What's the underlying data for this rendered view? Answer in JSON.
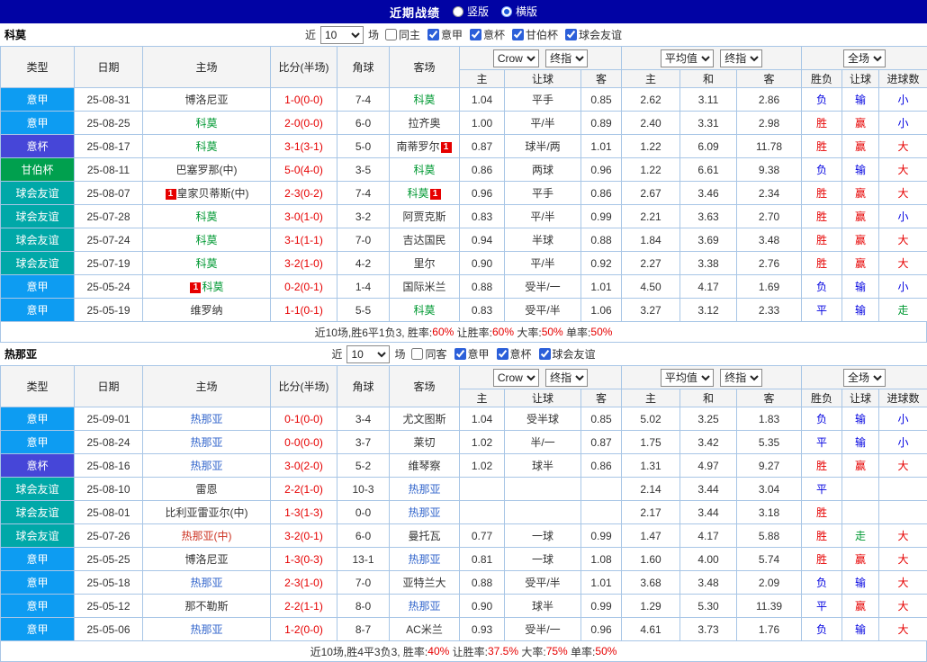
{
  "topbar": {
    "title": "近期战绩",
    "radios": [
      {
        "label": "竖版",
        "selected": false
      },
      {
        "label": "横版",
        "selected": true
      }
    ]
  },
  "colors": {
    "league": {
      "意甲": "#0d9cf2",
      "意杯": "#4646d8",
      "甘伯杯": "#00a04e",
      "球会友谊": "#00a8a8"
    },
    "result": {
      "red": "#e60000",
      "blue": "#0000e0",
      "green": "#009933"
    },
    "text_dark": "#333333",
    "score": "#e60000",
    "badge": "#e60000"
  },
  "head": {
    "type": "类型",
    "date": "日期",
    "home": "主场",
    "score": "比分(半场)",
    "corner": "角球",
    "away": "客场",
    "odds_selects": [
      "Crow",
      "终指"
    ],
    "avg_selects": [
      "平均值",
      "终指"
    ],
    "scope_selects": [
      "全场"
    ],
    "sub": [
      "主",
      "让球",
      "客",
      "主",
      "和",
      "客",
      "胜负",
      "让球",
      "进球数"
    ]
  },
  "tables": [
    {
      "team": "科莫",
      "focal_color": "#009933",
      "filter": {
        "near": "近",
        "count": "10",
        "games": "场",
        "checks": [
          {
            "label": "同主",
            "checked": false
          },
          {
            "label": "意甲",
            "checked": true
          },
          {
            "label": "意杯",
            "checked": true
          },
          {
            "label": "甘伯杯",
            "checked": true
          },
          {
            "label": "球会友谊",
            "checked": true
          }
        ]
      },
      "rows": [
        {
          "league": "意甲",
          "date": "25-08-31",
          "home": {
            "text": "博洛尼亚"
          },
          "score": "1-0(0-0)",
          "corner": "7-4",
          "away": {
            "text": "科莫",
            "focal": true
          },
          "odds": [
            "1.04",
            "平手",
            "0.85"
          ],
          "avg": [
            "2.62",
            "3.11",
            "2.86"
          ],
          "res": [
            {
              "t": "负",
              "c": "blue"
            },
            {
              "t": "输",
              "c": "blue"
            },
            {
              "t": "小",
              "c": "blue"
            }
          ]
        },
        {
          "league": "意甲",
          "date": "25-08-25",
          "home": {
            "text": "科莫",
            "focal": true
          },
          "score": "2-0(0-0)",
          "corner": "6-0",
          "away": {
            "text": "拉齐奥"
          },
          "odds": [
            "1.00",
            "平/半",
            "0.89"
          ],
          "avg": [
            "2.40",
            "3.31",
            "2.98"
          ],
          "res": [
            {
              "t": "胜",
              "c": "red"
            },
            {
              "t": "赢",
              "c": "red"
            },
            {
              "t": "小",
              "c": "blue"
            }
          ]
        },
        {
          "league": "意杯",
          "date": "25-08-17",
          "home": {
            "text": "科莫",
            "focal": true
          },
          "score": "3-1(3-1)",
          "corner": "5-0",
          "away": {
            "text": "南蒂罗尔",
            "post": "1"
          },
          "odds": [
            "0.87",
            "球半/两",
            "1.01"
          ],
          "avg": [
            "1.22",
            "6.09",
            "11.78"
          ],
          "res": [
            {
              "t": "胜",
              "c": "red"
            },
            {
              "t": "赢",
              "c": "red"
            },
            {
              "t": "大",
              "c": "red"
            }
          ]
        },
        {
          "league": "甘伯杯",
          "date": "25-08-11",
          "home": {
            "text": "巴塞罗那(中)"
          },
          "score": "5-0(4-0)",
          "corner": "3-5",
          "away": {
            "text": "科莫",
            "focal": true
          },
          "odds": [
            "0.86",
            "两球",
            "0.96"
          ],
          "avg": [
            "1.22",
            "6.61",
            "9.38"
          ],
          "res": [
            {
              "t": "负",
              "c": "blue"
            },
            {
              "t": "输",
              "c": "blue"
            },
            {
              "t": "大",
              "c": "red"
            }
          ]
        },
        {
          "league": "球会友谊",
          "date": "25-08-07",
          "home": {
            "pre": "1",
            "text": "皇家贝蒂斯(中)"
          },
          "score": "2-3(0-2)",
          "corner": "7-4",
          "away": {
            "text": "科莫",
            "focal": true,
            "post": "1"
          },
          "odds": [
            "0.96",
            "平手",
            "0.86"
          ],
          "avg": [
            "2.67",
            "3.46",
            "2.34"
          ],
          "res": [
            {
              "t": "胜",
              "c": "red"
            },
            {
              "t": "赢",
              "c": "red"
            },
            {
              "t": "大",
              "c": "red"
            }
          ]
        },
        {
          "league": "球会友谊",
          "date": "25-07-28",
          "home": {
            "text": "科莫",
            "focal": true
          },
          "score": "3-0(1-0)",
          "corner": "3-2",
          "away": {
            "text": "阿贾克斯"
          },
          "odds": [
            "0.83",
            "平/半",
            "0.99"
          ],
          "avg": [
            "2.21",
            "3.63",
            "2.70"
          ],
          "res": [
            {
              "t": "胜",
              "c": "red"
            },
            {
              "t": "赢",
              "c": "red"
            },
            {
              "t": "小",
              "c": "blue"
            }
          ]
        },
        {
          "league": "球会友谊",
          "date": "25-07-24",
          "home": {
            "text": "科莫",
            "focal": true
          },
          "score": "3-1(1-1)",
          "corner": "7-0",
          "away": {
            "text": "吉达国民"
          },
          "odds": [
            "0.94",
            "半球",
            "0.88"
          ],
          "avg": [
            "1.84",
            "3.69",
            "3.48"
          ],
          "res": [
            {
              "t": "胜",
              "c": "red"
            },
            {
              "t": "赢",
              "c": "red"
            },
            {
              "t": "大",
              "c": "red"
            }
          ]
        },
        {
          "league": "球会友谊",
          "date": "25-07-19",
          "home": {
            "text": "科莫",
            "focal": true
          },
          "score": "3-2(1-0)",
          "corner": "4-2",
          "away": {
            "text": "里尔"
          },
          "odds": [
            "0.90",
            "平/半",
            "0.92"
          ],
          "avg": [
            "2.27",
            "3.38",
            "2.76"
          ],
          "res": [
            {
              "t": "胜",
              "c": "red"
            },
            {
              "t": "赢",
              "c": "red"
            },
            {
              "t": "大",
              "c": "red"
            }
          ]
        },
        {
          "league": "意甲",
          "date": "25-05-24",
          "home": {
            "pre": "1",
            "text": "科莫",
            "focal": true
          },
          "score": "0-2(0-1)",
          "corner": "1-4",
          "away": {
            "text": "国际米兰"
          },
          "odds": [
            "0.88",
            "受半/一",
            "1.01"
          ],
          "avg": [
            "4.50",
            "4.17",
            "1.69"
          ],
          "res": [
            {
              "t": "负",
              "c": "blue"
            },
            {
              "t": "输",
              "c": "blue"
            },
            {
              "t": "小",
              "c": "blue"
            }
          ]
        },
        {
          "league": "意甲",
          "date": "25-05-19",
          "home": {
            "text": "维罗纳"
          },
          "score": "1-1(0-1)",
          "corner": "5-5",
          "away": {
            "text": "科莫",
            "focal": true
          },
          "odds": [
            "0.83",
            "受平/半",
            "1.06"
          ],
          "avg": [
            "3.27",
            "3.12",
            "2.33"
          ],
          "res": [
            {
              "t": "平",
              "c": "blue"
            },
            {
              "t": "输",
              "c": "blue"
            },
            {
              "t": "走",
              "c": "green"
            }
          ]
        }
      ],
      "summary": [
        {
          "t": "近10场,胜6平1负3, 胜率:",
          "c": "dark"
        },
        {
          "t": "60%",
          "c": "red"
        },
        {
          "t": " 让胜率:",
          "c": "dark"
        },
        {
          "t": "60%",
          "c": "red"
        },
        {
          "t": " 大率:",
          "c": "dark"
        },
        {
          "t": "50%",
          "c": "red"
        },
        {
          "t": " 单率:",
          "c": "dark"
        },
        {
          "t": "50%",
          "c": "red"
        }
      ]
    },
    {
      "team": "热那亚",
      "focal_color": "#3366cc",
      "filter": {
        "near": "近",
        "count": "10",
        "games": "场",
        "checks": [
          {
            "label": "同客",
            "checked": false
          },
          {
            "label": "意甲",
            "checked": true
          },
          {
            "label": "意杯",
            "checked": true
          },
          {
            "label": "球会友谊",
            "checked": true
          }
        ]
      },
      "rows": [
        {
          "league": "意甲",
          "date": "25-09-01",
          "home": {
            "text": "热那亚",
            "focal": true
          },
          "score": "0-1(0-0)",
          "corner": "3-4",
          "away": {
            "text": "尤文图斯"
          },
          "odds": [
            "1.04",
            "受半球",
            "0.85"
          ],
          "avg": [
            "5.02",
            "3.25",
            "1.83"
          ],
          "res": [
            {
              "t": "负",
              "c": "blue"
            },
            {
              "t": "输",
              "c": "blue"
            },
            {
              "t": "小",
              "c": "blue"
            }
          ]
        },
        {
          "league": "意甲",
          "date": "25-08-24",
          "home": {
            "text": "热那亚",
            "focal": true
          },
          "score": "0-0(0-0)",
          "corner": "3-7",
          "away": {
            "text": "莱切"
          },
          "odds": [
            "1.02",
            "半/一",
            "0.87"
          ],
          "avg": [
            "1.75",
            "3.42",
            "5.35"
          ],
          "res": [
            {
              "t": "平",
              "c": "blue"
            },
            {
              "t": "输",
              "c": "blue"
            },
            {
              "t": "小",
              "c": "blue"
            }
          ]
        },
        {
          "league": "意杯",
          "date": "25-08-16",
          "home": {
            "text": "热那亚",
            "focal": true
          },
          "score": "3-0(2-0)",
          "corner": "5-2",
          "away": {
            "text": "维琴察"
          },
          "odds": [
            "1.02",
            "球半",
            "0.86"
          ],
          "avg": [
            "1.31",
            "4.97",
            "9.27"
          ],
          "res": [
            {
              "t": "胜",
              "c": "red"
            },
            {
              "t": "赢",
              "c": "red"
            },
            {
              "t": "大",
              "c": "red"
            }
          ]
        },
        {
          "league": "球会友谊",
          "date": "25-08-10",
          "home": {
            "text": "雷恩"
          },
          "score": "2-2(1-0)",
          "corner": "10-3",
          "away": {
            "text": "热那亚",
            "focal": true
          },
          "odds": [
            "",
            "",
            ""
          ],
          "avg": [
            "2.14",
            "3.44",
            "3.04"
          ],
          "res": [
            {
              "t": "平",
              "c": "blue"
            },
            null,
            null
          ]
        },
        {
          "league": "球会友谊",
          "date": "25-08-01",
          "home": {
            "text": "比利亚雷亚尔(中)"
          },
          "score": "1-3(1-3)",
          "corner": "0-0",
          "away": {
            "text": "热那亚",
            "focal": true
          },
          "odds": [
            "",
            "",
            ""
          ],
          "avg": [
            "2.17",
            "3.44",
            "3.18"
          ],
          "res": [
            {
              "t": "胜",
              "c": "red"
            },
            null,
            null
          ]
        },
        {
          "league": "球会友谊",
          "date": "25-07-26",
          "home": {
            "text": "热那亚(中)",
            "color": "#cc3322"
          },
          "score": "3-2(0-1)",
          "corner": "6-0",
          "away": {
            "text": "曼托瓦"
          },
          "odds": [
            "0.77",
            "一球",
            "0.99"
          ],
          "avg": [
            "1.47",
            "4.17",
            "5.88"
          ],
          "res": [
            {
              "t": "胜",
              "c": "red"
            },
            {
              "t": "走",
              "c": "green"
            },
            {
              "t": "大",
              "c": "red"
            }
          ]
        },
        {
          "league": "意甲",
          "date": "25-05-25",
          "home": {
            "text": "博洛尼亚"
          },
          "score": "1-3(0-3)",
          "corner": "13-1",
          "away": {
            "text": "热那亚",
            "focal": true
          },
          "odds": [
            "0.81",
            "一球",
            "1.08"
          ],
          "avg": [
            "1.60",
            "4.00",
            "5.74"
          ],
          "res": [
            {
              "t": "胜",
              "c": "red"
            },
            {
              "t": "赢",
              "c": "red"
            },
            {
              "t": "大",
              "c": "red"
            }
          ]
        },
        {
          "league": "意甲",
          "date": "25-05-18",
          "home": {
            "text": "热那亚",
            "focal": true
          },
          "score": "2-3(1-0)",
          "corner": "7-0",
          "away": {
            "text": "亚特兰大"
          },
          "odds": [
            "0.88",
            "受平/半",
            "1.01"
          ],
          "avg": [
            "3.68",
            "3.48",
            "2.09"
          ],
          "res": [
            {
              "t": "负",
              "c": "blue"
            },
            {
              "t": "输",
              "c": "blue"
            },
            {
              "t": "大",
              "c": "red"
            }
          ]
        },
        {
          "league": "意甲",
          "date": "25-05-12",
          "home": {
            "text": "那不勒斯"
          },
          "score": "2-2(1-1)",
          "corner": "8-0",
          "away": {
            "text": "热那亚",
            "focal": true
          },
          "odds": [
            "0.90",
            "球半",
            "0.99"
          ],
          "avg": [
            "1.29",
            "5.30",
            "11.39"
          ],
          "res": [
            {
              "t": "平",
              "c": "blue"
            },
            {
              "t": "赢",
              "c": "red"
            },
            {
              "t": "大",
              "c": "red"
            }
          ]
        },
        {
          "league": "意甲",
          "date": "25-05-06",
          "home": {
            "text": "热那亚",
            "focal": true
          },
          "score": "1-2(0-0)",
          "corner": "8-7",
          "away": {
            "text": "AC米兰"
          },
          "odds": [
            "0.93",
            "受半/一",
            "0.96"
          ],
          "avg": [
            "4.61",
            "3.73",
            "1.76"
          ],
          "res": [
            {
              "t": "负",
              "c": "blue"
            },
            {
              "t": "输",
              "c": "blue"
            },
            {
              "t": "大",
              "c": "red"
            }
          ]
        }
      ],
      "summary": [
        {
          "t": "近10场,胜4平3负3, 胜率:",
          "c": "dark"
        },
        {
          "t": "40%",
          "c": "red"
        },
        {
          "t": " 让胜率:",
          "c": "dark"
        },
        {
          "t": "37.5%",
          "c": "red"
        },
        {
          "t": " 大率:",
          "c": "dark"
        },
        {
          "t": "75%",
          "c": "red"
        },
        {
          "t": " 单率:",
          "c": "dark"
        },
        {
          "t": "50%",
          "c": "red"
        }
      ]
    }
  ]
}
